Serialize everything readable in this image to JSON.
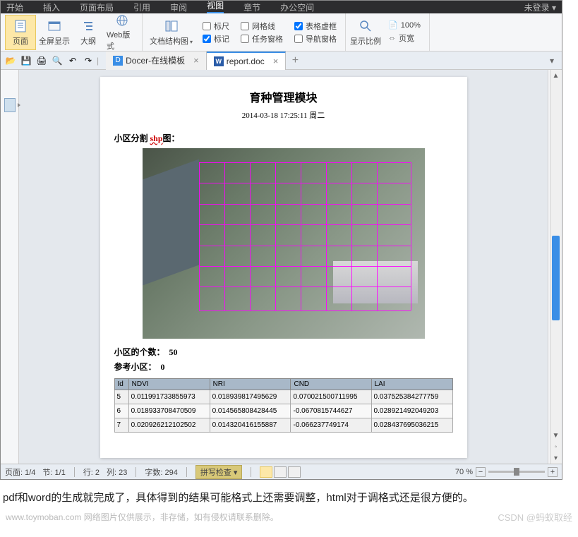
{
  "menubar": {
    "items": [
      "开始",
      "插入",
      "页面布局",
      "引用",
      "审阅",
      "视图",
      "章节",
      "办公空间"
    ],
    "active_index": 5,
    "right": "未登录 ▾"
  },
  "ribbon": {
    "view_buttons": [
      {
        "label": "页面",
        "icon": "page-view-icon",
        "active": true
      },
      {
        "label": "全屏显示",
        "icon": "fullscreen-icon"
      },
      {
        "label": "大纲",
        "icon": "outline-icon"
      },
      {
        "label": "Web版式",
        "icon": "web-layout-icon"
      }
    ],
    "structure_label": "文档结构图",
    "checkboxes_col1": [
      {
        "label": "标尺",
        "checked": false
      },
      {
        "label": "标记",
        "checked": true
      }
    ],
    "checkboxes_col2": [
      {
        "label": "网格线",
        "checked": false
      },
      {
        "label": "任务窗格",
        "checked": false
      }
    ],
    "checkboxes_col3": [
      {
        "label": "表格虚框",
        "checked": true
      },
      {
        "label": "导航窗格",
        "checked": false
      }
    ],
    "zoom_label": "显示比例",
    "hundred": "100%",
    "page_width": "页宽"
  },
  "qat": {
    "icons": [
      "open-icon",
      "save-icon",
      "print-icon",
      "print-preview-icon",
      "undo-icon",
      "redo-icon"
    ]
  },
  "tabs": [
    {
      "icon": "docer-icon",
      "label": "Docer-在线模板",
      "closable": true,
      "active": false
    },
    {
      "icon": "word-doc-icon",
      "label": "report.doc",
      "closable": true,
      "active": true
    }
  ],
  "document": {
    "title": "育种管理模块",
    "datetime": "2014-03-18 17:25:11 周二",
    "section1_prefix": "小区分割 ",
    "section1_red": "shp",
    "section1_suffix": "图：",
    "count_label": "小区的个数：",
    "count_value": "50",
    "ref_label": "参考小区：",
    "ref_value": "0",
    "table_headers": [
      "Id",
      "NDVI",
      "NRI",
      "CND",
      "LAI"
    ],
    "table_rows": [
      [
        "5",
        "0.011991733855973",
        "0.018939817495629",
        "0.070021500711995",
        "0.037525384277759"
      ],
      [
        "6",
        "0.018933708470509",
        "0.014565808428445",
        "-0.0670815744627",
        "0.028921492049203"
      ],
      [
        "7",
        "0.020926212102502",
        "0.014320416155887",
        "-0.066237749174",
        "0.028437695036215"
      ]
    ]
  },
  "statusbar": {
    "page": "页面: 1/4",
    "section": "节: 1/1",
    "row": "行: 2",
    "col": "列: 23",
    "chars": "字数: 294",
    "spell": "拼写检查",
    "zoom_pct": "70 %"
  },
  "caption": "pdf和word的生成就完成了，具体得到的结果可能格式上还需要调整，html对于调格式还是很方便的。",
  "watermark": {
    "left": "www.toymoban.com  网络图片仅供展示，非存储，如有侵权请联系删除。",
    "right": "CSDN @蚂蚁取经"
  }
}
